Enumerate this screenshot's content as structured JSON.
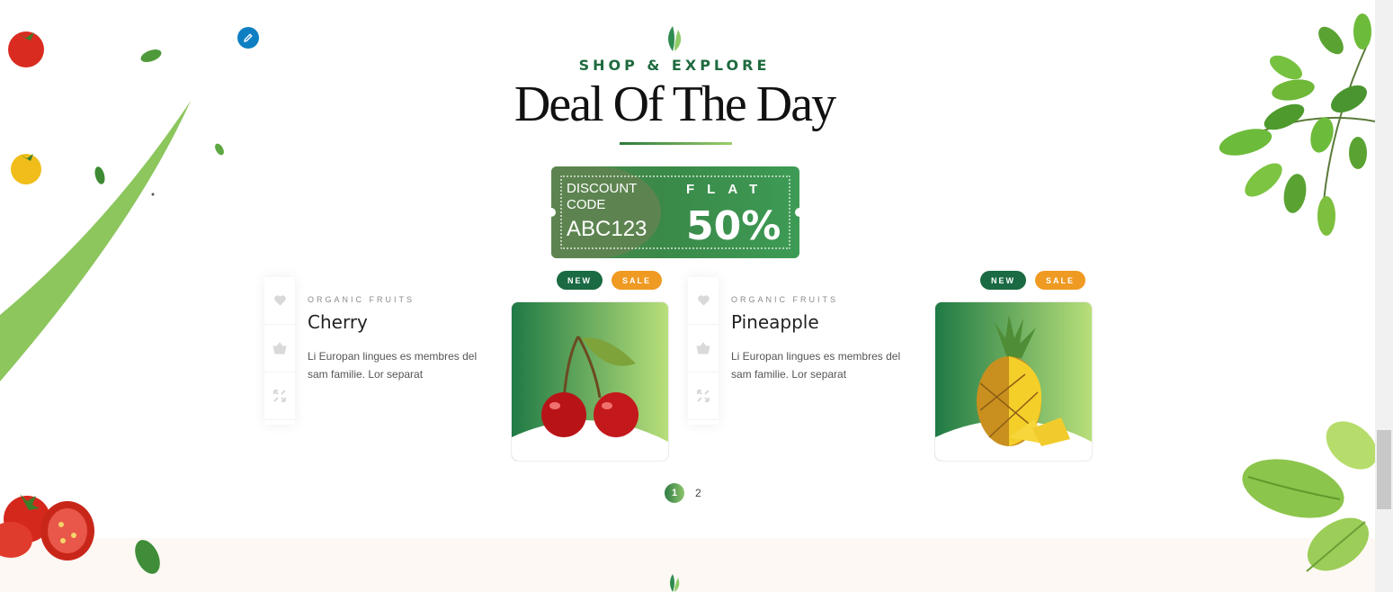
{
  "section": {
    "eyebrow": "SHOP & EXPLORE",
    "title": "Deal Of The Day"
  },
  "coupon": {
    "label": "DISCOUNT CODE",
    "code": "ABC123",
    "flat": "FLAT",
    "percent": "50%"
  },
  "products": [
    {
      "category": "ORGANIC FRUITS",
      "name": "Cherry",
      "description": "Li Europan lingues es membres del sam familie. Lor separat",
      "badge_new": "NEW",
      "badge_sale": "SALE"
    },
    {
      "category": "ORGANIC FRUITS",
      "name": "Pineapple",
      "description": "Li Europan lingues es membres del sam familie. Lor separat",
      "badge_new": "NEW",
      "badge_sale": "SALE"
    }
  ],
  "pagination": {
    "current": "1",
    "next": "2"
  },
  "colors": {
    "brand_green": "#1e6b3f",
    "sale_orange": "#ef9a22",
    "edit_blue": "#0f7fc3"
  },
  "icons": [
    "pencil-icon",
    "leaf-icon",
    "heart-icon",
    "basket-icon",
    "expand-icon"
  ]
}
